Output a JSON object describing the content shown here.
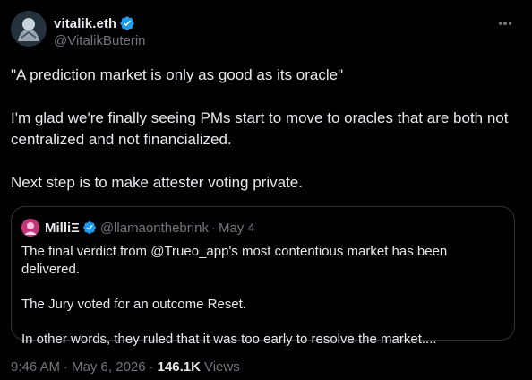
{
  "author": {
    "display_name": "vitalik.eth",
    "handle": "@VitalikButerin",
    "verified_icon": "verified-badge-icon"
  },
  "menu": {
    "icon": "more-options-icon"
  },
  "tweet": {
    "paragraphs": [
      "\"A prediction market is only as good as its oracle\"",
      "I'm glad we're finally seeing PMs start to move to oracles that are both not centralized and not financialized.",
      "Next step is to make attester voting private."
    ]
  },
  "quoted_tweet": {
    "display_name": "MilliΞ",
    "handle": "@llamaonthebrink",
    "separator": "·",
    "date": "May 4",
    "paragraphs": [
      "The final verdict from @Trueo_app's most contentious market has been delivered.",
      "The Jury voted for an outcome Reset.",
      "In other words, they ruled that it was too early to resolve the market...."
    ]
  },
  "meta": {
    "time": "9:46 AM",
    "separator": "·",
    "date": "May 6, 2026",
    "views_count": "146.1K",
    "views_label": "Views"
  },
  "colors": {
    "background": "#000000",
    "text_primary": "#e7e9ea",
    "text_secondary": "#71767b",
    "verified": "#1d9bf0",
    "border": "#2f3336"
  }
}
